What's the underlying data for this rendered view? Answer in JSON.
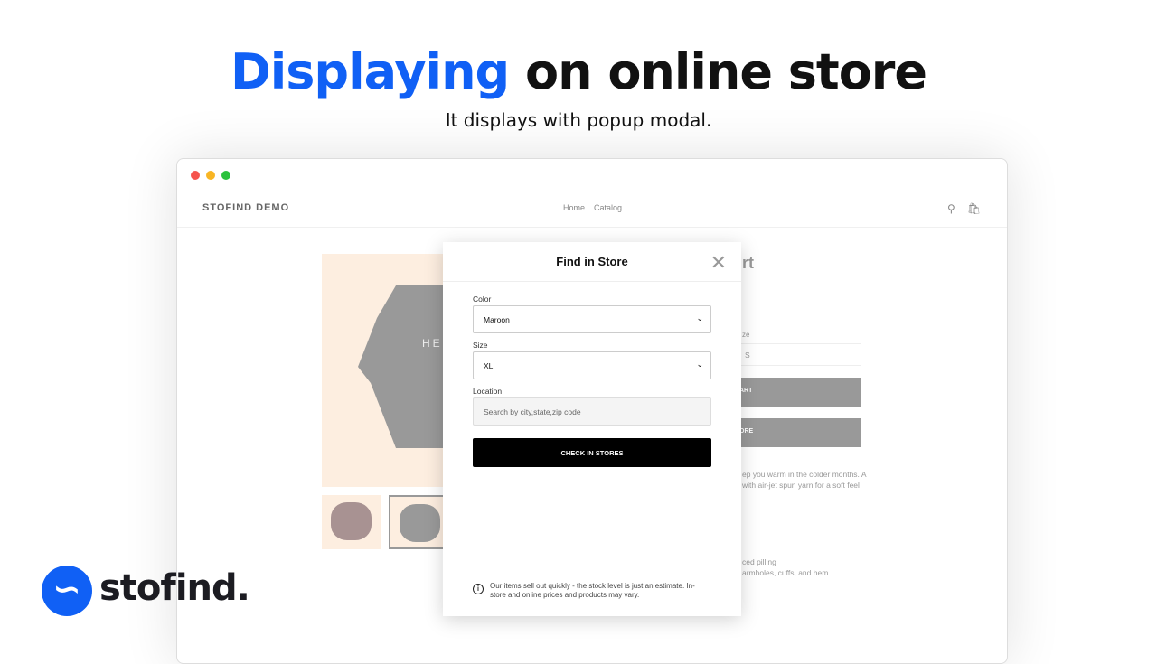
{
  "hero": {
    "accent": "Displaying",
    "rest": " on online store",
    "subtitle": "It displays with popup modal."
  },
  "store": {
    "brand": "STOFIND DEMO",
    "nav": [
      "Home",
      "Catalog"
    ],
    "cart_count": "1",
    "title_fragment": "rt",
    "size_label_fragment": "ze",
    "size_value": "S",
    "btn1_fragment": "ART",
    "btn2_fragment": "ORE",
    "desc": [
      "ep you warm in the colder months. A",
      "with air-jet spun yarn for a soft feel"
    ],
    "features": [
      "ced pilling",
      "armholes, cuffs, and hem"
    ],
    "product_print": "HEL"
  },
  "modal": {
    "title": "Find in Store",
    "color_label": "Color",
    "color_value": "Maroon",
    "size_label": "Size",
    "size_value": "XL",
    "location_label": "Location",
    "location_placeholder": "Search by city,state,zip code",
    "cta": "CHECK IN STORES",
    "note": "Our items sell out quickly - the stock level is just an estimate. In-store and online prices and products may vary."
  },
  "brand": {
    "name": "stofind.",
    "accent_color": "#1060f5"
  }
}
